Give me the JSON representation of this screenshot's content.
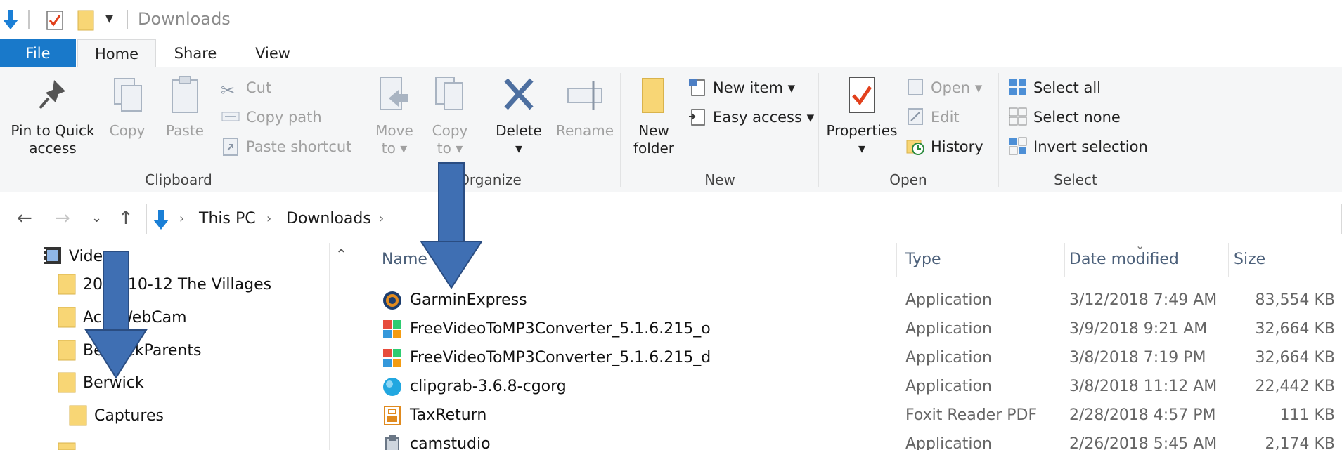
{
  "window": {
    "title": "Downloads"
  },
  "ribbon": {
    "tabs": [
      {
        "label": "File"
      },
      {
        "label": "Home"
      },
      {
        "label": "Share"
      },
      {
        "label": "View"
      }
    ],
    "clipboard": {
      "pin_label_1": "Pin to Quick",
      "pin_label_2": "access",
      "copy_label": "Copy",
      "paste_label": "Paste",
      "cut_label": "Cut",
      "copy_path_label": "Copy path",
      "paste_shortcut_label": "Paste shortcut",
      "group_label": "Clipboard"
    },
    "organize": {
      "move_label_1": "Move",
      "move_label_2": "to",
      "copyto_label_1": "Copy",
      "copyto_label_2": "to",
      "delete_label": "Delete",
      "rename_label": "Rename",
      "group_label": "Organize"
    },
    "new": {
      "new_folder_1": "New",
      "new_folder_2": "folder",
      "new_item_label": "New item",
      "easy_access_label": "Easy access",
      "group_label": "New"
    },
    "open": {
      "properties_label": "Properties",
      "open_label": "Open",
      "edit_label": "Edit",
      "history_label": "History",
      "group_label": "Open"
    },
    "select": {
      "select_all_label": "Select all",
      "select_none_label": "Select none",
      "invert_label": "Invert selection",
      "group_label": "Select"
    }
  },
  "address": {
    "crumbs": [
      "This PC",
      "Downloads"
    ]
  },
  "navpane": {
    "items": [
      {
        "label": "Videos",
        "icon": "videos-icon"
      },
      {
        "label": "2018-10-12 The Villages",
        "icon": "folder-icon"
      },
      {
        "label": "AcerWebCam",
        "icon": "folder-icon"
      },
      {
        "label": "BerwickParents",
        "icon": "folder-icon"
      },
      {
        "label": "Berwick",
        "icon": "folder-icon"
      },
      {
        "label": "Captures",
        "icon": "folder-icon"
      }
    ]
  },
  "filelist": {
    "columns": {
      "name": "Name",
      "type": "Type",
      "date": "Date modified",
      "size": "Size"
    },
    "rows": [
      {
        "name": "GarminExpress",
        "type": "Application",
        "date": "3/12/2018 7:49 AM",
        "size": "83,554 KB",
        "icon": "garmin-icon"
      },
      {
        "name": "FreeVideoToMP3Converter_5.1.6.215_o",
        "type": "Application",
        "date": "3/9/2018 9:21 AM",
        "size": "32,664 KB",
        "icon": "app-tiles-icon"
      },
      {
        "name": "FreeVideoToMP3Converter_5.1.6.215_d",
        "type": "Application",
        "date": "3/8/2018 7:19 PM",
        "size": "32,664 KB",
        "icon": "app-tiles-icon"
      },
      {
        "name": "clipgrab-3.6.8-cgorg",
        "type": "Application",
        "date": "3/8/2018 11:12 AM",
        "size": "22,442 KB",
        "icon": "clipgrab-icon"
      },
      {
        "name": "TaxReturn",
        "type": "Foxit Reader PDF ...",
        "date": "2/28/2018 4:57 PM",
        "size": "111 KB",
        "icon": "pdf-icon"
      },
      {
        "name": "camstudio",
        "type": "Application",
        "date": "2/26/2018 5:45 AM",
        "size": "2,174 KB",
        "icon": "installer-icon"
      }
    ]
  },
  "colors": {
    "accent": "#1979ca",
    "arrow_fill": "#3f6fb3",
    "arrow_stroke": "#2a4d82",
    "folder": "#f8d675"
  }
}
